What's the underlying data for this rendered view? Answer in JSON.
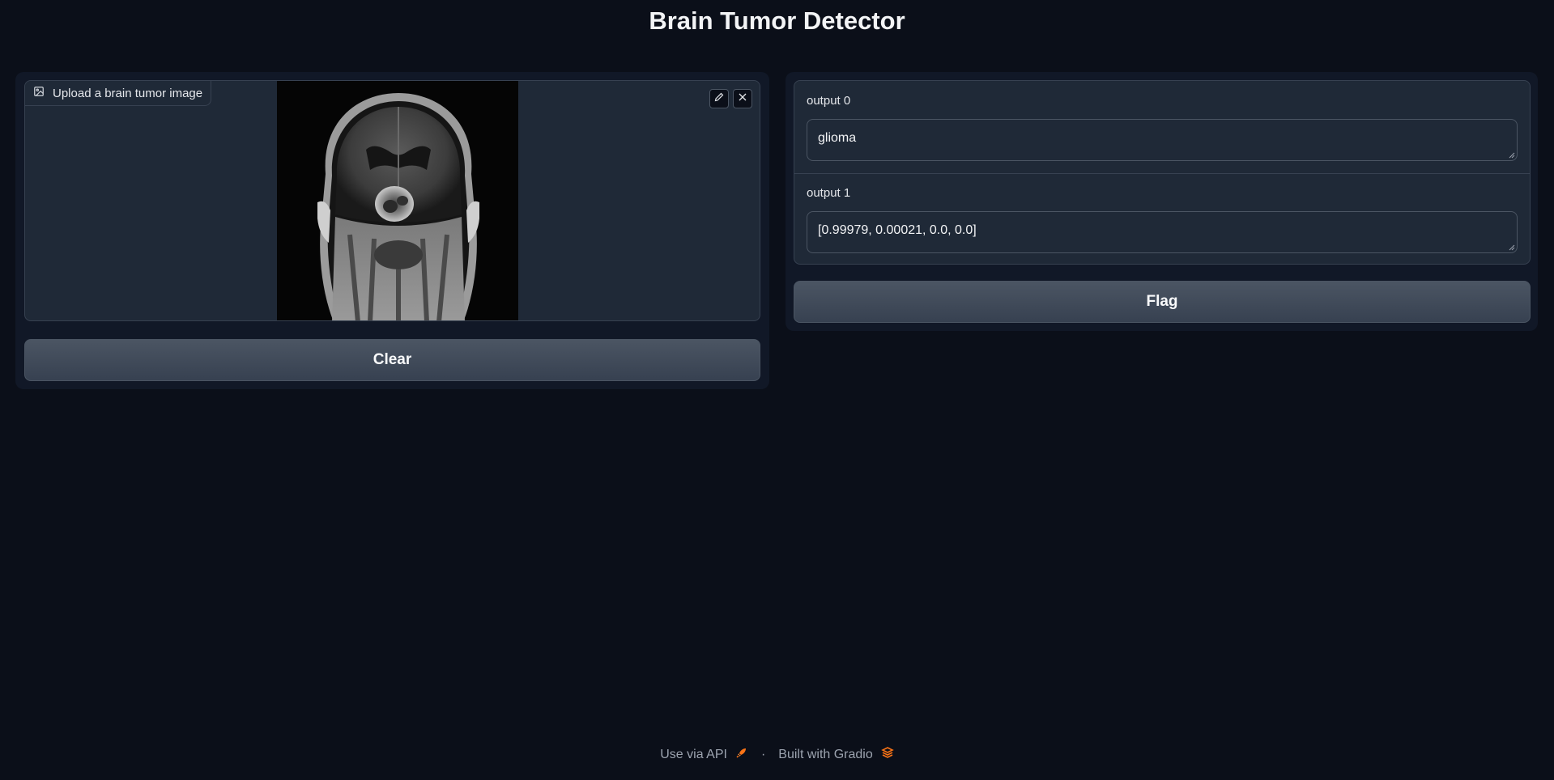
{
  "page": {
    "title": "Brain Tumor Detector"
  },
  "input": {
    "image_label": "Upload a brain tumor image",
    "clear_label": "Clear"
  },
  "outputs": [
    {
      "label": "output 0",
      "value": "glioma"
    },
    {
      "label": "output 1",
      "value": "[0.99979, 0.00021, 0.0, 0.0]"
    }
  ],
  "actions": {
    "flag_label": "Flag"
  },
  "footer": {
    "api_label": "Use via API",
    "separator": "·",
    "built_label": "Built with Gradio"
  },
  "colors": {
    "background": "#0b0f19",
    "panel": "#111827",
    "block": "#1f2937",
    "border": "#374151",
    "accent": "#f97316"
  },
  "icons": [
    "image-icon",
    "pencil-icon",
    "close-icon",
    "rocket-icon",
    "gradio-logo-icon"
  ]
}
